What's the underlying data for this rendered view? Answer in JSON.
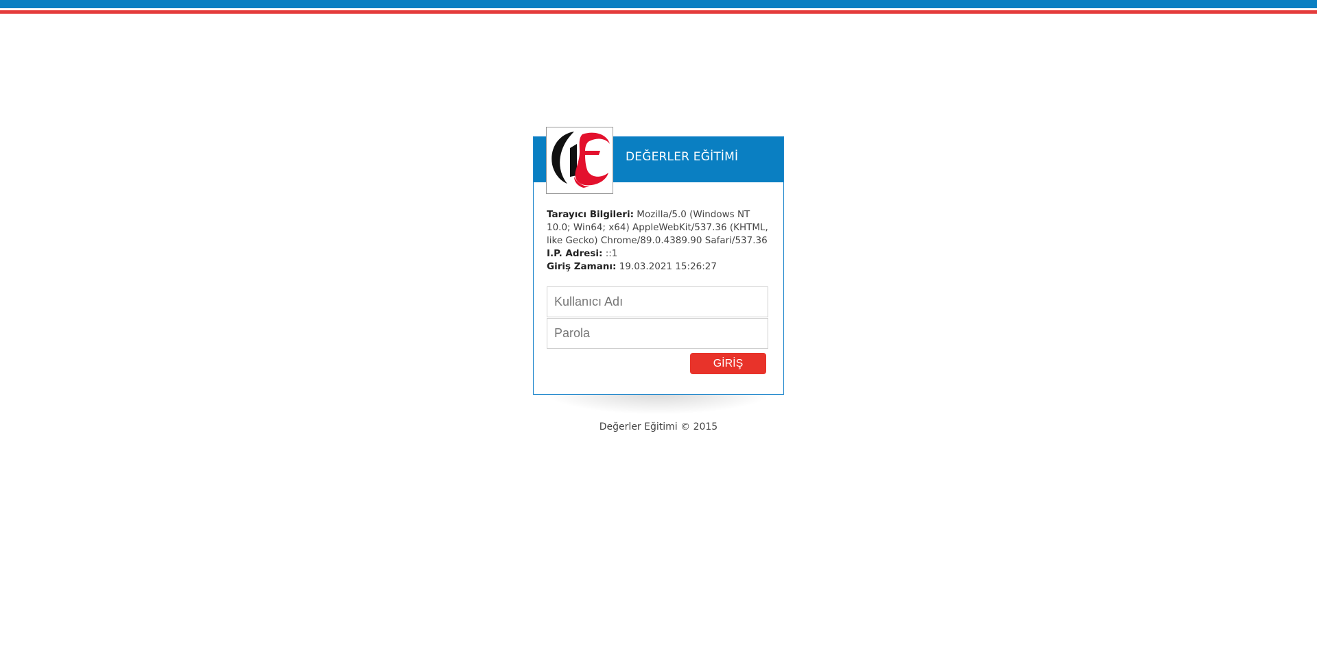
{
  "header": {
    "title": "DEĞERLER EĞİTİMİ"
  },
  "info": {
    "browser_label": "Tarayıcı Bilgileri:",
    "browser_value": "Mozilla/5.0 (Windows NT 10.0; Win64; x64) AppleWebKit/537.36 (KHTML, like Gecko) Chrome/89.0.4389.90 Safari/537.36",
    "ip_label": "I.P. Adresi:",
    "ip_value": "::1",
    "time_label": "Giriş Zamanı:",
    "time_value": "19.03.2021 15:26:27"
  },
  "form": {
    "username_placeholder": "Kullanıcı Adı",
    "username_value": "",
    "password_placeholder": "Parola",
    "password_value": "",
    "submit_label": "GİRİŞ"
  },
  "footer": {
    "text": "Değerler Eğitimi © 2015"
  },
  "colors": {
    "brand_blue": "#0a7fc2",
    "brand_red": "#e43b3b",
    "button_red": "#e8332a"
  },
  "icons": {
    "logo": "de-logo"
  }
}
